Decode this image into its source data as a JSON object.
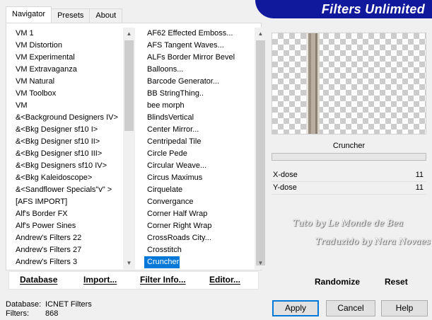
{
  "window": {
    "banner_title": "Filters Unlimited"
  },
  "tabs": [
    {
      "label": "Navigator",
      "active": true
    },
    {
      "label": "Presets",
      "active": false
    },
    {
      "label": "About",
      "active": false
    }
  ],
  "categories": [
    "VM 1",
    "VM Distortion",
    "VM Experimental",
    "VM Extravaganza",
    "VM Natural",
    "VM Toolbox",
    "VM",
    "&<Background Designers IV>",
    "&<Bkg Designer sf10 I>",
    "&<Bkg Designer sf10 II>",
    "&<Bkg Designer sf10 III>",
    "&<Bkg Designers sf10 IV>",
    "&<Bkg Kaleidoscope>",
    "&<Sandflower Specials\"v\" >",
    "[AFS IMPORT]",
    "Alf's Border FX",
    "Alf's Power Sines",
    "Andrew's Filters 22",
    "Andrew's Filters 27",
    "Andrew's Filters 3"
  ],
  "filters": [
    "AF62 Effected Emboss...",
    "AFS Tangent Waves...",
    "ALFs Border Mirror Bevel",
    "Balloons...",
    "Barcode Generator...",
    "BB StringThing..",
    "bee morph",
    "BlindsVertical",
    "Center Mirror...",
    "Centripedal Tile",
    "Circle Pede",
    "Circular Weave...",
    "Circus Maximus",
    "Cirquelate",
    "Convergance",
    "Corner Half Wrap",
    "Corner Right Wrap",
    "CrossRoads City...",
    "Crosstitch",
    "Cruncher"
  ],
  "selected_filter": "Cruncher",
  "database_buttons": {
    "database": "Database",
    "import": "Import...",
    "filter_info": "Filter Info...",
    "editor": "Editor..."
  },
  "preview": {
    "filter_name": "Cruncher"
  },
  "params": [
    {
      "name": "X-dose",
      "value": "11"
    },
    {
      "name": "Y-dose",
      "value": "11"
    }
  ],
  "watermark": {
    "line1": "Tuto by Le Monde de Bea",
    "line2": "Traduzido by Nara Novaes"
  },
  "right_buttons": {
    "randomize": "Randomize",
    "reset": "Reset"
  },
  "footer": {
    "database_label": "Database:",
    "database_value": "ICNET Filters",
    "filters_label": "Filters:",
    "filters_value": "868"
  },
  "dialog_buttons": {
    "apply": "Apply",
    "cancel": "Cancel",
    "help": "Help"
  },
  "colors": {
    "banner": "#10199c",
    "selection": "#0078d7"
  }
}
